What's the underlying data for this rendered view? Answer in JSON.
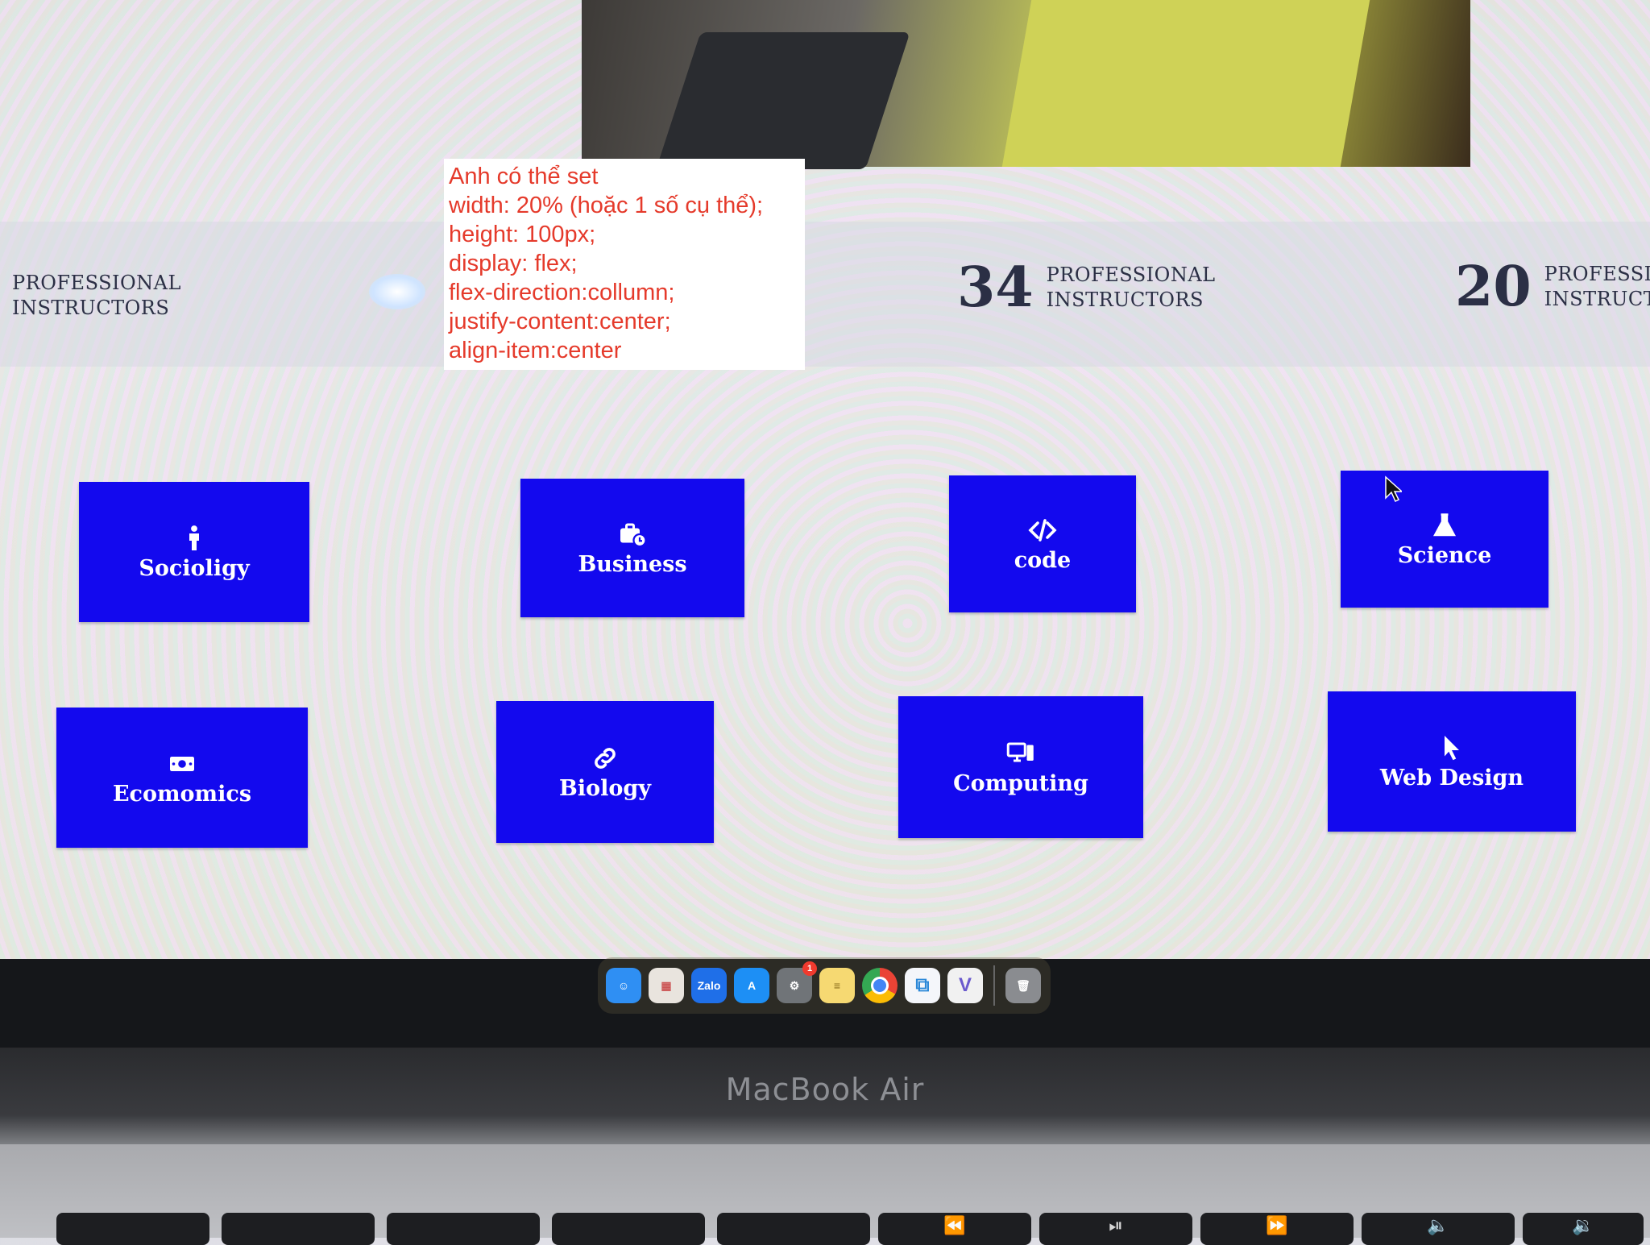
{
  "note": {
    "lines": [
      "Anh có thể set",
      "width: 20% (hoặc 1 số cụ thể);",
      "height: 100px;",
      "display: flex;",
      "flex-direction:collumn;",
      "justify-content:center;",
      "align-item:center"
    ]
  },
  "stats": [
    {
      "number": "",
      "label_line1": "PROFESSIONAL",
      "label_line2": "INSTRUCTORS"
    },
    {
      "number": "34",
      "label_line1": "PROFESSIONAL",
      "label_line2": "INSTRUCTORS"
    },
    {
      "number": "20",
      "label_line1": "PROFESSION.",
      "label_line2": "INSTRUCTOR"
    }
  ],
  "categories": [
    {
      "label": "Socioligy",
      "icon": "person-icon"
    },
    {
      "label": "Business",
      "icon": "briefcase-clock-icon"
    },
    {
      "label": "code",
      "icon": "code-icon"
    },
    {
      "label": "Science",
      "icon": "flask-icon"
    },
    {
      "label": "Ecomomics",
      "icon": "money-bill-icon"
    },
    {
      "label": "Biology",
      "icon": "link-icon"
    },
    {
      "label": "Computing",
      "icon": "desktop-mobile-icon"
    },
    {
      "label": "Web Design",
      "icon": "pointer-icon"
    }
  ],
  "dock": {
    "apps": [
      {
        "name": "Finder",
        "color": "#2f8ff3"
      },
      {
        "name": "Launchpad",
        "color": "#e9e4de"
      },
      {
        "name": "Zalo",
        "color": "#1f6fe8"
      },
      {
        "name": "App Store",
        "color": "#1d8ff5"
      },
      {
        "name": "System Settings",
        "color": "#707478"
      },
      {
        "name": "Notes",
        "color": "#f6d972"
      },
      {
        "name": "Chrome",
        "color": "#e8b52d"
      },
      {
        "name": "VS Code",
        "color": "#2b88d8"
      },
      {
        "name": "Cursor App",
        "color": "#f1f1f1"
      },
      {
        "name": "Trash",
        "color": "#8a8c90"
      }
    ],
    "zalo_label": "Zalo",
    "settings_badge": "1"
  },
  "brand": "MacBook Air",
  "colors": {
    "card_blue": "#1309ee",
    "note_red": "#e53a2b",
    "stat_text": "#2b2f45"
  }
}
